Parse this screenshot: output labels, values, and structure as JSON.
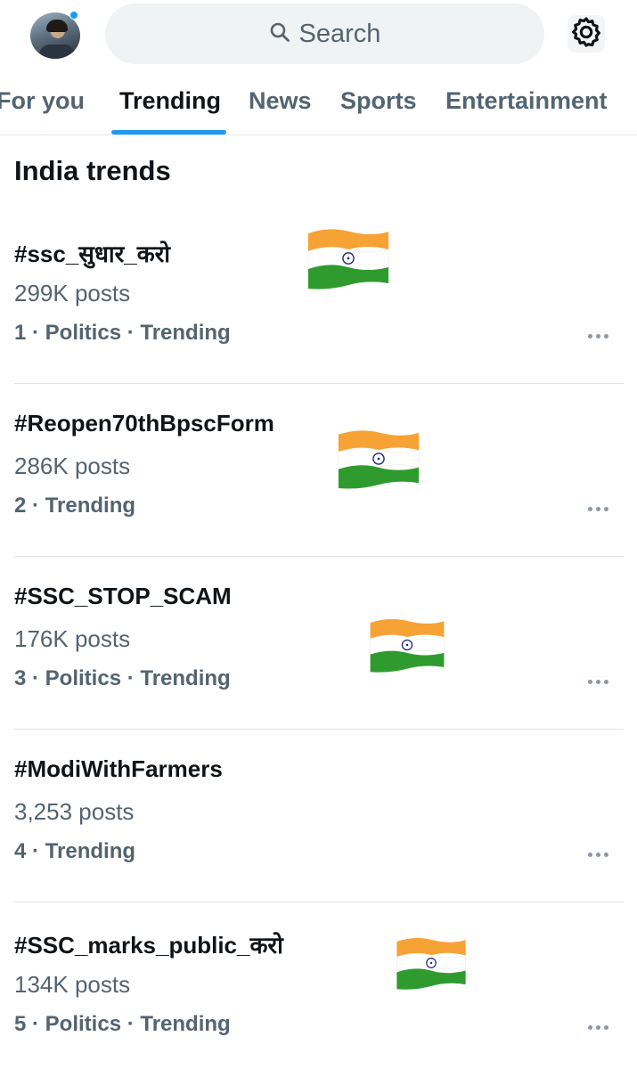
{
  "header": {
    "search_placeholder": "Search"
  },
  "tabs": [
    {
      "label": "For you"
    },
    {
      "label": "Trending"
    },
    {
      "label": "News"
    },
    {
      "label": "Sports"
    },
    {
      "label": "Entertainment"
    }
  ],
  "active_tab": "Trending",
  "section_title": "India trends",
  "trends": [
    {
      "rank": "1",
      "name": "#ssc_सुधार_करो",
      "posts": "299K posts",
      "meta": "1 · Politics · Trending"
    },
    {
      "rank": "2",
      "name": "#Reopen70thBpscForm",
      "posts": "286K posts",
      "meta": "2 · Trending"
    },
    {
      "rank": "3",
      "name": "#SSC_STOP_SCAM",
      "posts": "176K posts",
      "meta": "3 · Politics · Trending"
    },
    {
      "rank": "4",
      "name": "#ModiWithFarmers",
      "posts": "3,253 posts",
      "meta": "4 · Trending"
    },
    {
      "rank": "5",
      "name": "#SSC_marks_public_करो",
      "posts": "134K posts",
      "meta": "5 · Politics · Trending"
    }
  ],
  "colors": {
    "accent": "#1d9bf0",
    "text_primary": "#0f1419",
    "text_secondary": "#536471",
    "flag_saffron": "#f7a235",
    "flag_green": "#2f9b2f",
    "flag_chakra": "#1a237e"
  },
  "icons": {
    "search": "search-icon",
    "settings": "gear-icon",
    "more": "more-horizontal-icon",
    "flag": "india-flag-icon"
  }
}
